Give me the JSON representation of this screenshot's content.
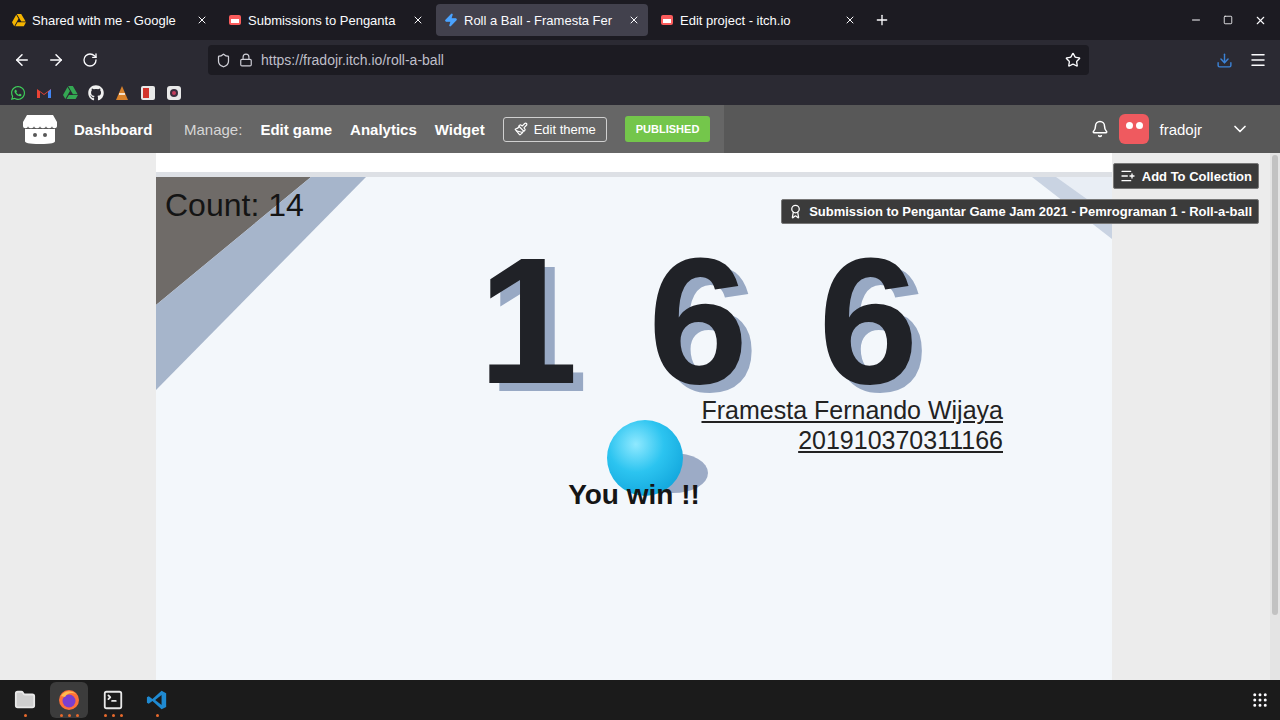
{
  "browser": {
    "tabs": [
      {
        "label": "Shared with me - Google",
        "kind": "drive",
        "selected": false
      },
      {
        "label": "Submissions to Penganta",
        "kind": "itch",
        "selected": false
      },
      {
        "label": "Roll a Ball - Framesta Fer",
        "kind": "unity",
        "selected": true
      },
      {
        "label": "Edit project - itch.io",
        "kind": "itch",
        "selected": false
      }
    ],
    "url": "https://fradojr.itch.io/roll-a-ball",
    "bookmarks": [
      {
        "kind": "whatsapp"
      },
      {
        "kind": "gmail"
      },
      {
        "kind": "drive"
      },
      {
        "kind": "github"
      },
      {
        "kind": "cone"
      },
      {
        "kind": "red"
      },
      {
        "kind": "camera"
      }
    ]
  },
  "itch_header": {
    "dashboard": "Dashboard",
    "manage_label": "Manage:",
    "links": [
      "Edit game",
      "Analytics",
      "Widget"
    ],
    "edit_theme": "Edit theme",
    "status": "PUBLISHED",
    "username": "fradojr"
  },
  "page": {
    "add_to_collection": "Add To Collection",
    "submission_badge": "Submission to Pengantar Game Jam 2021 - Pemrograman 1 - Roll-a-ball"
  },
  "game": {
    "count": "Count: 14",
    "blocks": "166",
    "author": "Framesta Fernando Wijaya",
    "student_id": "201910370311166",
    "message": "You win !!"
  },
  "taskbar": {
    "apps": [
      {
        "kind": "files",
        "selected": false,
        "windows": 1
      },
      {
        "kind": "firefox",
        "selected": true,
        "windows": 3
      },
      {
        "kind": "terminal",
        "selected": false,
        "windows": 3
      },
      {
        "kind": "vscode",
        "selected": false,
        "windows": 1
      }
    ]
  }
}
